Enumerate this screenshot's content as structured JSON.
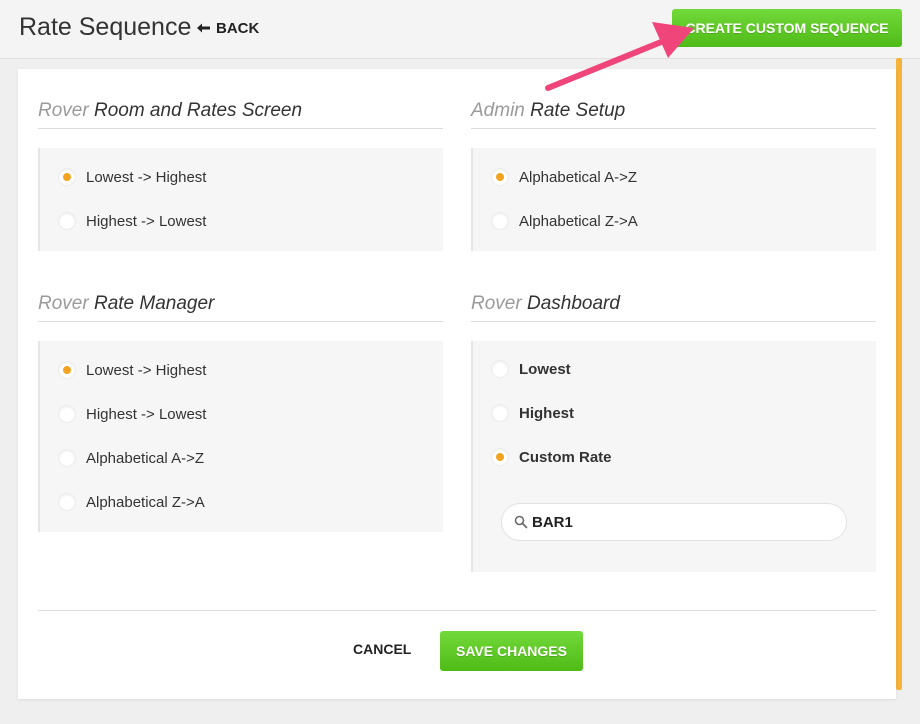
{
  "header": {
    "title": "Rate Sequence",
    "back_label": "BACK",
    "create_label": "CREATE CUSTOM SEQUENCE"
  },
  "sections": [
    {
      "title_prefix": "Rover",
      "title_main": "Room and Rates Screen",
      "options": [
        {
          "label": "Lowest -> Highest",
          "selected": true
        },
        {
          "label": "Highest -> Lowest",
          "selected": false
        }
      ]
    },
    {
      "title_prefix": "Admin",
      "title_main": "Rate Setup",
      "options": [
        {
          "label": "Alphabetical A->Z",
          "selected": true
        },
        {
          "label": "Alphabetical Z->A",
          "selected": false
        }
      ]
    },
    {
      "title_prefix": "Rover",
      "title_main": "Rate Manager",
      "options": [
        {
          "label": "Lowest -> Highest",
          "selected": true
        },
        {
          "label": "Highest -> Lowest",
          "selected": false
        },
        {
          "label": "Alphabetical A->Z",
          "selected": false
        },
        {
          "label": "Alphabetical Z->A",
          "selected": false
        }
      ]
    },
    {
      "title_prefix": "Rover",
      "title_main": "Dashboard",
      "options": [
        {
          "label": "Lowest",
          "selected": false
        },
        {
          "label": "Highest",
          "selected": false
        },
        {
          "label": "Custom Rate",
          "selected": true
        }
      ],
      "search_value": "BAR1"
    }
  ],
  "footer": {
    "cancel_label": "CANCEL",
    "save_label": "SAVE CHANGES"
  },
  "colors": {
    "accent_green": "#5cc825",
    "radio_selected": "#f4a321",
    "scrollbar": "#f5b33a",
    "annotation_arrow": "#f0457a"
  },
  "icons": {
    "back": "arrow-left-icon",
    "search": "search-icon",
    "annotation": "annotation-arrow-icon"
  }
}
